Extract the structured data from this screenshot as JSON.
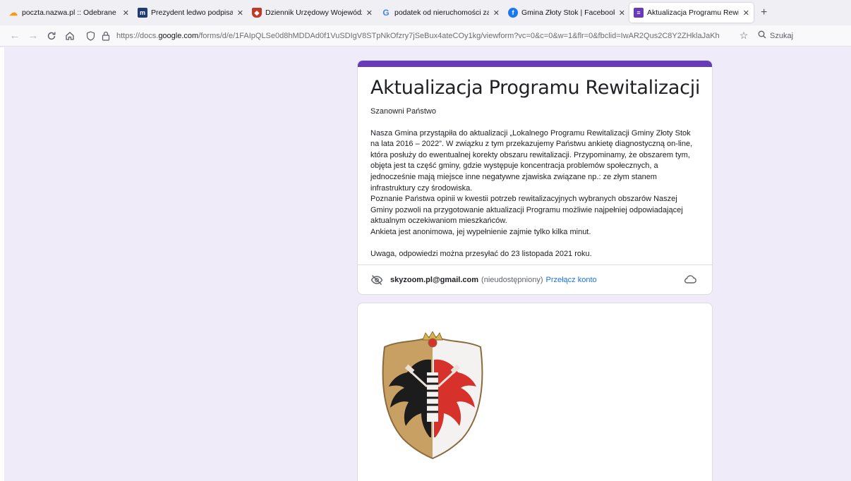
{
  "browser": {
    "tabs": [
      {
        "title": "poczta.nazwa.pl :: Odebrane",
        "favicon": "cloud-mail-icon",
        "color": "#f39c12",
        "closable": true,
        "active": false
      },
      {
        "title": "Prezydent ledwo podpisał Polsk",
        "favicon": "m-logo-icon",
        "color": "#1f3b73",
        "closable": true,
        "active": false
      },
      {
        "title": "Dziennik Urzędowy Województw",
        "favicon": "crest-icon",
        "color": "#c0392b",
        "closable": true,
        "active": false
      },
      {
        "title": "podatek od nieruchomości zaję",
        "favicon": "google-icon",
        "color": "#4285f4",
        "closable": true,
        "active": false
      },
      {
        "title": "Gmina Złoty Stok | Facebook",
        "favicon": "facebook-icon",
        "color": "#1877f2",
        "closable": true,
        "active": false
      },
      {
        "title": "Aktualizacja Programu Rewitaliz",
        "favicon": "forms-icon",
        "color": "#673ab7",
        "closable": true,
        "active": true
      }
    ],
    "close_glyph": "✕",
    "new_tab_glyph": "+",
    "url_prefix": "https://docs.",
    "url_host": "google.com",
    "url_rest": "/forms/d/e/1FAIpQLSe0d8hMDDAd0f1VuSDIgV8STpNkOfzry7jSeBux4ateCOy1kg/viewform?vc=0&c=0&w=1&flr=0&fbclid=IwAR2Qus2C8Y2ZHklaJaKh",
    "search_placeholder": "Szukaj",
    "accent": "#673ab7"
  },
  "form": {
    "title": "Aktualizacja Programu Rewitalizacji",
    "greeting": "Szanowni Państwo",
    "paragraphs": [
      "Nasza Gmina przystąpiła do aktualizacji „Lokalnego Programu Rewitalizacji Gminy Złoty Stok na lata 2016 – 2022”. W związku z tym przekazujemy Państwu ankietę diagnostyczną on-line, która posłuży do ewentualnej korekty obszaru rewitalizacji. Przypominamy, że obszarem tym, objęta jest ta część gminy, gdzie występuje koncentracja problemów społecznych, a jednocześnie mają miejsce inne negatywne zjawiska związane np.: ze złym stanem infrastruktury czy środowiska.",
      "Poznanie Państwa opinii w kwestii potrzeb rewitalizacyjnych wybranych obszarów Naszej Gminy pozwoli  na przygotowanie aktualizacji Programu możliwie najpełniej odpowiadającej aktualnym oczekiwaniom mieszkańców.",
      "Ankieta jest anonimowa, jej wypełnienie zajmie tylko kilka minut."
    ],
    "deadline": "Uwaga, odpowiedzi można przesyłać do 23 listopada 2021 roku.",
    "account_email": "skyzoom.pl@gmail.com",
    "account_status": "(nieudostępniony)",
    "switch_account": "Przełącz konto"
  }
}
